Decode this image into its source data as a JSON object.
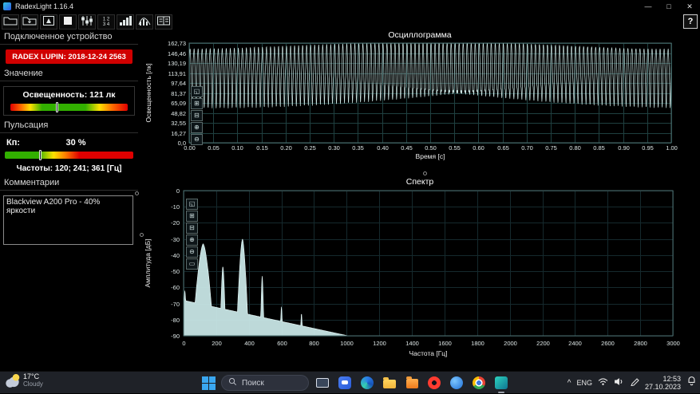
{
  "window": {
    "title": "RadexLight 1.16.4",
    "minimize_glyph": "—",
    "maximize_glyph": "□",
    "close_glyph": "✕"
  },
  "toolbar": {
    "help_label": "?",
    "button_names": [
      "open-file",
      "save-file",
      "export-report",
      "color-scheme",
      "levels",
      "channels-1234",
      "bar-chart",
      "histogram",
      "split-view"
    ]
  },
  "left_panel": {
    "device": {
      "heading": "Подключенное устройство",
      "name": "RADEX LUPIN: 2018-12-24 2563"
    },
    "value": {
      "heading": "Значение",
      "illuminance": "Освещенность: 121 лк",
      "marker_percent": 40
    },
    "pulsation": {
      "heading": "Пульсация",
      "kp_label": "Кп:",
      "kp_value": "30 %",
      "marker_percent": 28,
      "frequencies": "Частоты: 120; 241; 361 [Гц]"
    },
    "comments": {
      "heading": "Комментарии",
      "text": "Blackview A200 Pro - 40% яркости"
    }
  },
  "chart_data": [
    {
      "type": "line",
      "title": "Осциллограмма",
      "xlabel": "Время [с]",
      "ylabel": "Освещенность [лк]",
      "xlim": [
        0,
        1
      ],
      "ylim": [
        0,
        162.73
      ],
      "x_ticks": [
        "0.00",
        "0.05",
        "0.10",
        "0.15",
        "0.20",
        "0.25",
        "0.30",
        "0.35",
        "0.40",
        "0.45",
        "0.50",
        "0.55",
        "0.60",
        "0.65",
        "0.70",
        "0.75",
        "0.80",
        "0.85",
        "0.90",
        "0.95",
        "1.00"
      ],
      "y_ticks": [
        "162,73",
        "146,46",
        "130,19",
        "113,91",
        "97,64",
        "81,37",
        "65,09",
        "48,82",
        "32,55",
        "16,27",
        "0,0"
      ],
      "signal": {
        "mean_lux": 115,
        "harmonics": [
          {
            "freq_hz": 120,
            "amp": 44
          },
          {
            "freq_hz": 241,
            "amp": 10
          },
          {
            "freq_hz": 361,
            "amp": 5
          }
        ]
      },
      "line_color": "#d8f2f0",
      "grid_color": "#1f4040",
      "grid": true,
      "legend": false
    },
    {
      "type": "area",
      "title": "Спектр",
      "xlabel": "Частота [Гц]",
      "ylabel": "Амплитуда [дБ]",
      "xlim": [
        0,
        3000
      ],
      "ylim": [
        -90,
        0
      ],
      "x_tick_step": 200,
      "y_tick_step": 10,
      "noise_floor_db": {
        "start": -68,
        "end": -92,
        "knee_hz": 1100
      },
      "peaks": [
        {
          "freq_hz": 8,
          "level_db": -62,
          "width": 6
        },
        {
          "freq_hz": 120,
          "level_db": -33,
          "width": 22
        },
        {
          "freq_hz": 241,
          "level_db": -47,
          "width": 7
        },
        {
          "freq_hz": 361,
          "level_db": -30,
          "width": 12
        },
        {
          "freq_hz": 482,
          "level_db": -53,
          "width": 5
        },
        {
          "freq_hz": 600,
          "level_db": -72,
          "width": 5
        },
        {
          "freq_hz": 723,
          "level_db": -76,
          "width": 5
        }
      ],
      "fill_color": "#cdeceb",
      "grid_color": "#15292d",
      "grid": true,
      "legend": false
    }
  ],
  "chart_tools": {
    "osc": [
      {
        "name": "select-zoom-tool",
        "glyph": "◱"
      },
      {
        "name": "zoom-x-in-tool",
        "glyph": "⊞"
      },
      {
        "name": "zoom-x-out-tool",
        "glyph": "⊟"
      },
      {
        "name": "zoom-in-tool",
        "glyph": "⊕"
      },
      {
        "name": "zoom-out-tool",
        "glyph": "⊖"
      }
    ],
    "spec": [
      {
        "name": "select-zoom-tool",
        "glyph": "◱"
      },
      {
        "name": "zoom-x-in-tool",
        "glyph": "⊞"
      },
      {
        "name": "zoom-x-out-tool",
        "glyph": "⊟"
      },
      {
        "name": "zoom-in-tool",
        "glyph": "⊕"
      },
      {
        "name": "zoom-out-tool",
        "glyph": "⊖"
      },
      {
        "name": "pan-tool",
        "glyph": "▭"
      }
    ]
  },
  "taskbar": {
    "weather": {
      "temp": "17°C",
      "condition": "Cloudy"
    },
    "search": {
      "placeholder": "Поиск"
    },
    "app_icons": [
      "monitor",
      "chat",
      "edge",
      "file-explorer",
      "office-folder",
      "opera",
      "blue-browser",
      "chrome",
      "radexlight"
    ],
    "tray": {
      "chevron": "^",
      "language": "ENG",
      "time": "12:53",
      "date": "27.10.2023"
    }
  }
}
